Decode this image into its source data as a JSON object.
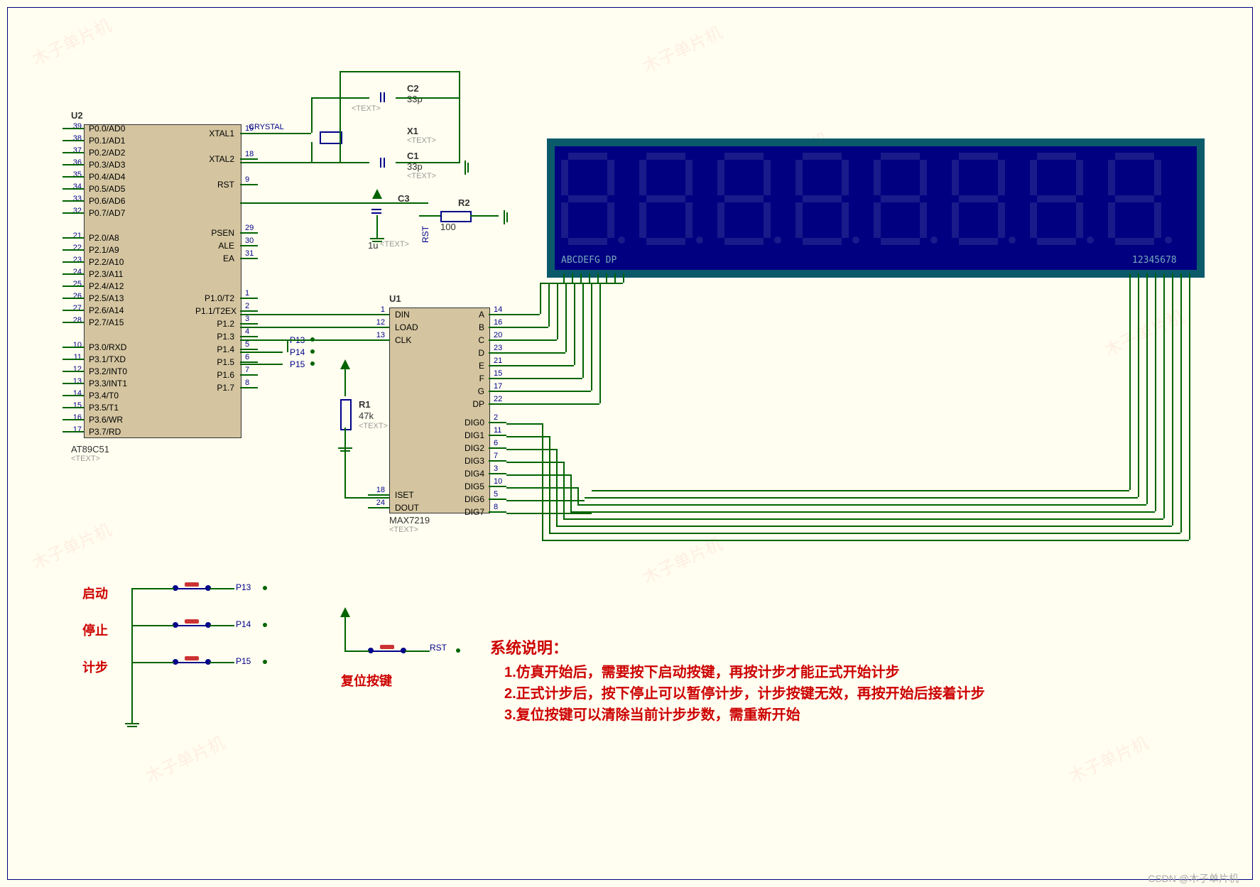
{
  "u2": {
    "ref": "U2",
    "part": "AT89C51",
    "txt": "<TEXT>",
    "left_pins": [
      {
        "num": "39",
        "name": "P0.0/AD0"
      },
      {
        "num": "38",
        "name": "P0.1/AD1"
      },
      {
        "num": "37",
        "name": "P0.2/AD2"
      },
      {
        "num": "36",
        "name": "P0.3/AD3"
      },
      {
        "num": "35",
        "name": "P0.4/AD4"
      },
      {
        "num": "34",
        "name": "P0.5/AD5"
      },
      {
        "num": "33",
        "name": "P0.6/AD6"
      },
      {
        "num": "32",
        "name": "P0.7/AD7"
      },
      {
        "num": "21",
        "name": "P2.0/A8"
      },
      {
        "num": "22",
        "name": "P2.1/A9"
      },
      {
        "num": "23",
        "name": "P2.2/A10"
      },
      {
        "num": "24",
        "name": "P2.3/A11"
      },
      {
        "num": "25",
        "name": "P2.4/A12"
      },
      {
        "num": "26",
        "name": "P2.5/A13"
      },
      {
        "num": "27",
        "name": "P2.6/A14"
      },
      {
        "num": "28",
        "name": "P2.7/A15"
      },
      {
        "num": "10",
        "name": "P3.0/RXD"
      },
      {
        "num": "11",
        "name": "P3.1/TXD"
      },
      {
        "num": "12",
        "name": "P3.2/INT0"
      },
      {
        "num": "13",
        "name": "P3.3/INT1"
      },
      {
        "num": "14",
        "name": "P3.4/T0"
      },
      {
        "num": "15",
        "name": "P3.5/T1"
      },
      {
        "num": "16",
        "name": "P3.6/WR"
      },
      {
        "num": "17",
        "name": "P3.7/RD"
      }
    ],
    "right_pins": [
      {
        "num": "19",
        "name": "XTAL1"
      },
      {
        "num": "",
        "name": ""
      },
      {
        "num": "18",
        "name": "XTAL2"
      },
      {
        "num": "",
        "name": ""
      },
      {
        "num": "9",
        "name": "RST"
      },
      {
        "num": "",
        "name": ""
      },
      {
        "num": "",
        "name": ""
      },
      {
        "num": "29",
        "name": "PSEN"
      },
      {
        "num": "30",
        "name": "ALE"
      },
      {
        "num": "31",
        "name": "EA"
      },
      {
        "num": "",
        "name": ""
      },
      {
        "num": "1",
        "name": "P1.0/T2"
      },
      {
        "num": "2",
        "name": "P1.1/T2EX"
      },
      {
        "num": "3",
        "name": "P1.2"
      },
      {
        "num": "4",
        "name": "P1.3"
      },
      {
        "num": "5",
        "name": "P1.4"
      },
      {
        "num": "6",
        "name": "P1.5"
      },
      {
        "num": "7",
        "name": "P1.6"
      },
      {
        "num": "8",
        "name": "P1.7"
      }
    ],
    "crystal_label": "CRYSTAL"
  },
  "u1": {
    "ref": "U1",
    "part": "MAX7219",
    "txt": "<TEXT>",
    "left_pins": [
      {
        "num": "1",
        "name": "DIN"
      },
      {
        "num": "12",
        "name": "LOAD"
      },
      {
        "num": "13",
        "name": "CLK"
      },
      {
        "num": "",
        "name": ""
      },
      {
        "num": "",
        "name": ""
      },
      {
        "num": "",
        "name": ""
      },
      {
        "num": "",
        "name": ""
      },
      {
        "num": "",
        "name": ""
      },
      {
        "num": "18",
        "name": "ISET"
      },
      {
        "num": "24",
        "name": "DOUT"
      }
    ],
    "right_pins": [
      {
        "num": "14",
        "name": "A"
      },
      {
        "num": "16",
        "name": "B"
      },
      {
        "num": "20",
        "name": "C"
      },
      {
        "num": "23",
        "name": "D"
      },
      {
        "num": "21",
        "name": "E"
      },
      {
        "num": "15",
        "name": "F"
      },
      {
        "num": "17",
        "name": "G"
      },
      {
        "num": "22",
        "name": "DP"
      },
      {
        "num": "2",
        "name": "DIG0"
      },
      {
        "num": "11",
        "name": "DIG1"
      },
      {
        "num": "6",
        "name": "DIG2"
      },
      {
        "num": "7",
        "name": "DIG3"
      },
      {
        "num": "3",
        "name": "DIG4"
      },
      {
        "num": "10",
        "name": "DIG5"
      },
      {
        "num": "5",
        "name": "DIG6"
      },
      {
        "num": "8",
        "name": "DIG7"
      }
    ]
  },
  "components": {
    "c1": {
      "ref": "C1",
      "val": "33p",
      "txt": "<TEXT>"
    },
    "c2": {
      "ref": "C2",
      "val": "33p",
      "txt": "<TEXT>"
    },
    "c3": {
      "ref": "C3",
      "val": "1u",
      "txt": "<TEXT>"
    },
    "x1": {
      "ref": "X1",
      "txt": "<TEXT>"
    },
    "r1": {
      "ref": "R1",
      "val": "47k",
      "txt": "<TEXT>"
    },
    "r2": {
      "ref": "R2",
      "val": "100"
    }
  },
  "net_labels": {
    "p13": "P13",
    "p14": "P14",
    "p15": "P15",
    "rst": "RST"
  },
  "display": {
    "left_legend": "ABCDEFG DP",
    "right_legend": "12345678"
  },
  "buttons": {
    "start": "启动",
    "stop": "停止",
    "step": "计步",
    "reset": "复位按键"
  },
  "notes": {
    "title": "系统说明：",
    "l1": "1.仿真开始后，需要按下启动按键，再按计步才能正式开始计步",
    "l2": "2.正式计步后，按下停止可以暂停计步，计步按键无效，再按开始后接着计步",
    "l3": "3.复位按键可以清除当前计步步数，需重新开始"
  },
  "watermark_text": "木子单片机",
  "csdn": "CSDN @木子单片机"
}
